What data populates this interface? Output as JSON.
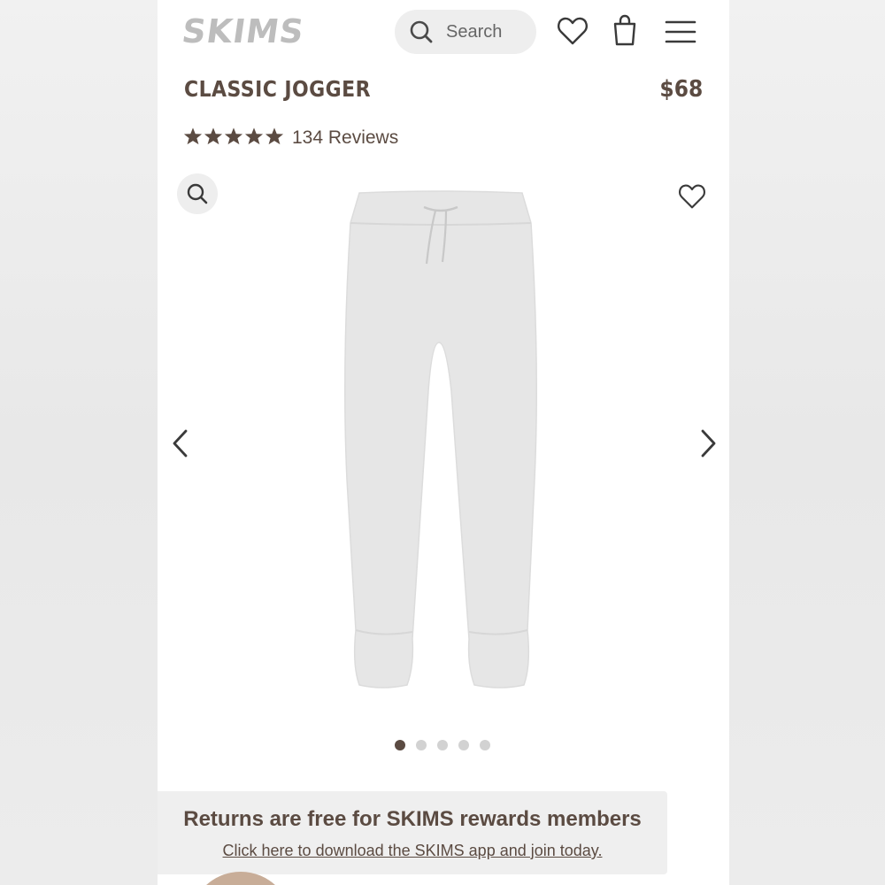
{
  "header": {
    "logo": "SKIMS",
    "search_label": "Search"
  },
  "product": {
    "title": "CLASSIC JOGGER",
    "price": "$68",
    "rating": 5,
    "reviews": "134 Reviews"
  },
  "gallery": {
    "image_count": 5,
    "active_index": 0
  },
  "banner": {
    "title": "Returns are free for SKIMS rewards members",
    "link": "Click here to download the SKIMS app and join today."
  },
  "colors": {
    "brand_text": "#5b4b42",
    "logo": "#bdbdbd",
    "accent_bubble": "#c8ad98"
  }
}
